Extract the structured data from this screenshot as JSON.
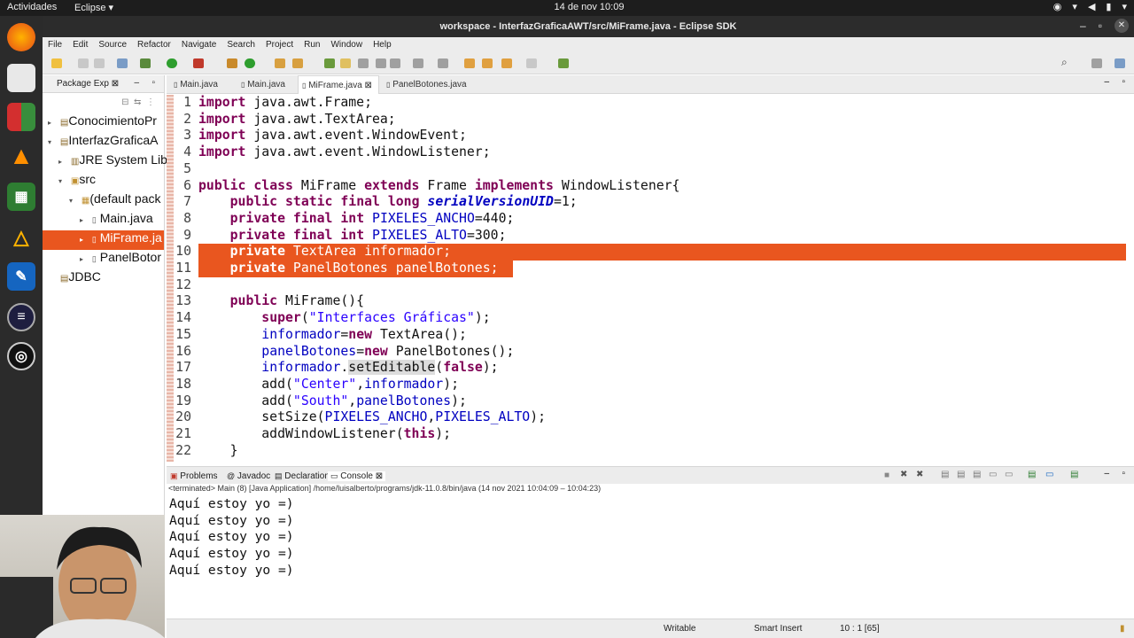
{
  "topbar": {
    "activities": "Actividades",
    "app": "Eclipse ▾",
    "clock": "14 de nov  10:09"
  },
  "window": {
    "title": "workspace - InterfazGraficaAWT/src/MiFrame.java - Eclipse SDK"
  },
  "menu": [
    "File",
    "Edit",
    "Source",
    "Refactor",
    "Navigate",
    "Search",
    "Project",
    "Run",
    "Window",
    "Help"
  ],
  "package_explorer": {
    "title": "Package Exp ⊠",
    "items": [
      {
        "label": "ConocimientoPr",
        "tw": "▸"
      },
      {
        "label": "InterfazGraficaA",
        "tw": "▾"
      },
      {
        "label": "JRE System Lib",
        "tw": "▸"
      },
      {
        "label": "src",
        "tw": "▾"
      },
      {
        "label": "(default pack",
        "tw": "▾"
      },
      {
        "label": "Main.java",
        "tw": "▸"
      },
      {
        "label": "MiFrame.ja",
        "tw": "▸"
      },
      {
        "label": "PanelBotor",
        "tw": "▸"
      },
      {
        "label": "JDBC",
        "tw": ""
      }
    ]
  },
  "editor_tabs": [
    "Main.java",
    "Main.java",
    "MiFrame.java ⊠",
    "PanelBotones.java"
  ],
  "code": [
    {
      "n": "1",
      "t": "import java.awt.Frame;"
    },
    {
      "n": "2",
      "t": "import java.awt.TextArea;"
    },
    {
      "n": "3",
      "t": "import java.awt.event.WindowEvent;"
    },
    {
      "n": "4",
      "t": "import java.awt.event.WindowListener;"
    },
    {
      "n": "5",
      "t": ""
    },
    {
      "n": "6",
      "t": "public class MiFrame extends Frame implements WindowListener{"
    },
    {
      "n": "7",
      "t": "    public static final long serialVersionUID=1;"
    },
    {
      "n": "8",
      "t": "    private final int PIXELES_ANCHO=440;"
    },
    {
      "n": "9",
      "t": "    private final int PIXELES_ALTO=300;"
    },
    {
      "n": "10",
      "t": "    private TextArea informador;"
    },
    {
      "n": "11",
      "t": "    private PanelBotones panelBotones;"
    },
    {
      "n": "12",
      "t": ""
    },
    {
      "n": "13",
      "t": "    public MiFrame(){"
    },
    {
      "n": "14",
      "t": "        super(\"Interfaces Gráficas\");"
    },
    {
      "n": "15",
      "t": "        informador=new TextArea();"
    },
    {
      "n": "16",
      "t": "        panelBotones=new PanelBotones();"
    },
    {
      "n": "17",
      "t": "        informador.setEditable(false);"
    },
    {
      "n": "18",
      "t": "        add(\"Center\",informador);"
    },
    {
      "n": "19",
      "t": "        add(\"South\",panelBotones);"
    },
    {
      "n": "20",
      "t": "        setSize(PIXELES_ANCHO,PIXELES_ALTO);"
    },
    {
      "n": "21",
      "t": "        addWindowListener(this);"
    },
    {
      "n": "22",
      "t": "    }"
    }
  ],
  "bottom_tabs": [
    "Problems",
    "Javadoc",
    "Declaration",
    "Console ⊠"
  ],
  "console": {
    "header": "<terminated> Main (8) [Java Application] /home/luisalberto/programs/jdk-11.0.8/bin/java  (14 nov 2021 10:04:09 – 10:04:23)",
    "lines": [
      "Aquí estoy yo =)",
      "Aquí estoy yo =)",
      "Aquí estoy yo =)",
      "Aquí estoy yo =)",
      "Aquí estoy yo =)"
    ]
  },
  "status": {
    "writable": "Writable",
    "insert": "Smart Insert",
    "pos": "10 : 1 [65]"
  },
  "colors": {
    "selection": "#e9561f",
    "keyword": "#7f0055",
    "field": "#0000c0",
    "string": "#2a00ff"
  }
}
